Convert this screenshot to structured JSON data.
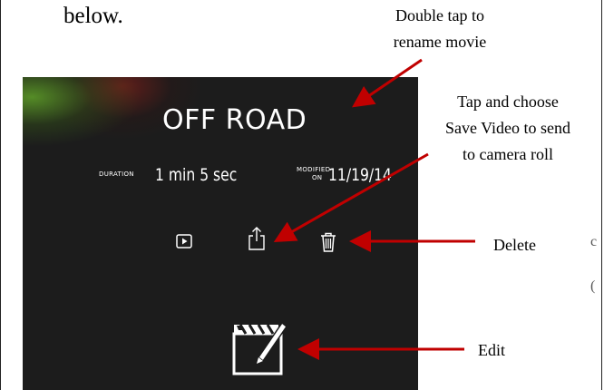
{
  "document": {
    "intro_text": "below.",
    "right_edge_glyphs": [
      "c",
      "("
    ]
  },
  "app_screen": {
    "movie_title": "OFF ROAD",
    "duration_label": "DURATION",
    "duration_value": "1 min 5 sec",
    "modified_label_top": "MODIFIED",
    "modified_label_bottom": "ON",
    "modified_value": "11/19/14",
    "icons": [
      "play-icon",
      "share-icon",
      "trash-icon",
      "clapperboard-edit-icon"
    ]
  },
  "annotations": {
    "rename": [
      "Double tap to",
      "rename movie"
    ],
    "save": [
      "Tap and choose",
      "Save Video to send",
      "to camera roll"
    ],
    "delete": "Delete",
    "edit": "Edit"
  },
  "colors": {
    "app_background": "#1c1c1c",
    "arrow": "#c00000",
    "text_white": "#ffffff"
  }
}
